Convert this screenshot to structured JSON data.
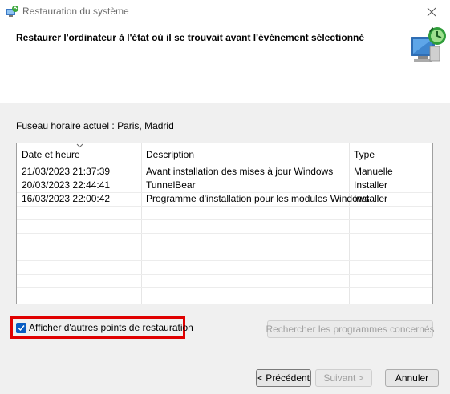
{
  "window": {
    "title": "Restauration du système",
    "close_icon": "close-icon"
  },
  "header": {
    "title": "Restaurer l'ordinateur à l'état où il se trouvait avant l'événement sélectionné",
    "illustration_icon": "system-restore-icon"
  },
  "timezone_label": "Fuseau horaire actuel : Paris, Madrid",
  "table": {
    "columns": [
      "Date et heure",
      "Description",
      "Type"
    ],
    "sorted_column": "Date et heure",
    "rows": [
      {
        "date": "21/03/2023 21:37:39",
        "description": "Avant installation des mises à jour Windows",
        "type": "Manuelle"
      },
      {
        "date": "20/03/2023 22:44:41",
        "description": "TunnelBear",
        "type": "Installer"
      },
      {
        "date": "16/03/2023 22:00:42",
        "description": "Programme d'installation pour les modules Windows",
        "type": "Installer"
      }
    ]
  },
  "show_more": {
    "label": "Afficher d'autres points de restauration",
    "checked": true,
    "highlight_color": "#e00000"
  },
  "scan_button": {
    "label": "Rechercher les programmes concernés",
    "enabled": false
  },
  "footer": {
    "back_label": "< Précédent",
    "next_label": "Suivant >",
    "next_enabled": false,
    "cancel_label": "Annuler"
  },
  "colors": {
    "accent": "#0a5cc2",
    "highlight": "#e00000"
  }
}
